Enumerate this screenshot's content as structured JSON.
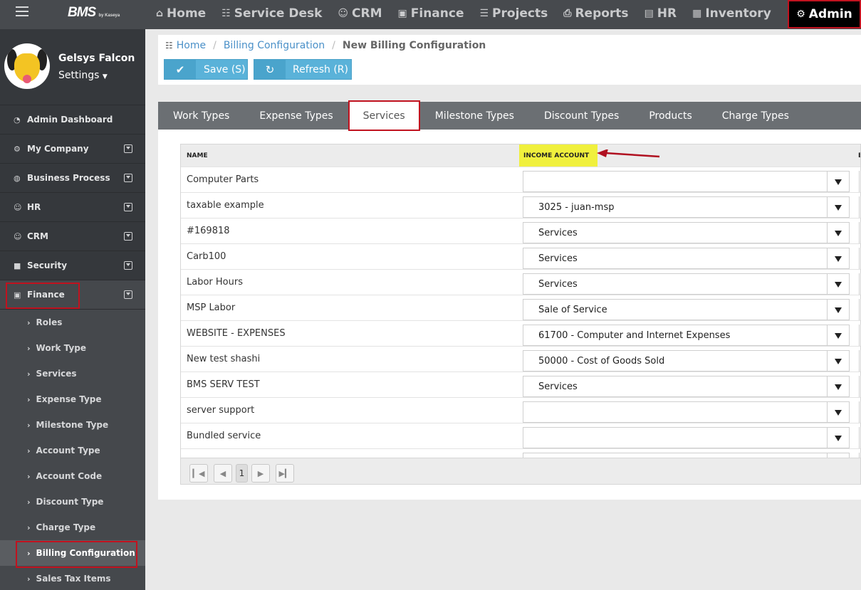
{
  "topbar": {
    "brand": "BMS",
    "brand_sub": "by Kaseya",
    "nav": [
      {
        "label": "Home",
        "icon": "home-icon",
        "glyph": "⌂"
      },
      {
        "label": "Service Desk",
        "icon": "sitemap-icon",
        "glyph": "☷"
      },
      {
        "label": "CRM",
        "icon": "users-icon",
        "glyph": "☺"
      },
      {
        "label": "Finance",
        "icon": "money-icon",
        "glyph": "▣"
      },
      {
        "label": "Projects",
        "icon": "tasks-icon",
        "glyph": "☰"
      },
      {
        "label": "Reports",
        "icon": "print-icon",
        "glyph": "⎙"
      },
      {
        "label": "HR",
        "icon": "briefcase-icon",
        "glyph": "▤"
      },
      {
        "label": "Inventory",
        "icon": "building-icon",
        "glyph": "▦"
      }
    ],
    "admin": {
      "label": "Admin",
      "icon": "gear-icon",
      "glyph": "⚙"
    }
  },
  "profile": {
    "name": "Gelsys Falcon",
    "settings_label": "Settings"
  },
  "sidebar": {
    "items": [
      {
        "label": "Admin Dashboard",
        "glyph": "◔"
      },
      {
        "label": "My Company",
        "glyph": "⚙"
      },
      {
        "label": "Business Process",
        "glyph": "◍"
      },
      {
        "label": "HR",
        "glyph": "☺"
      },
      {
        "label": "CRM",
        "glyph": "☺"
      },
      {
        "label": "Security",
        "glyph": "■"
      },
      {
        "label": "Finance",
        "glyph": "▣"
      }
    ],
    "finance_sub": [
      "Roles",
      "Work Type",
      "Services",
      "Expense Type",
      "Milestone Type",
      "Account Type",
      "Account Code",
      "Discount Type",
      "Charge Type",
      "Billing Configuration",
      "Sales Tax Items"
    ]
  },
  "breadcrumb": {
    "home": "Home",
    "parent": "Billing Configuration",
    "current": "New Billing Configuration"
  },
  "toolbar": {
    "save_label": "Save (S)",
    "refresh_label": "Refresh (R)"
  },
  "tabs": [
    "Work Types",
    "Expense Types",
    "Services",
    "Milestone Types",
    "Discount Types",
    "Products",
    "Charge Types"
  ],
  "active_tab": "Services",
  "grid": {
    "headers": {
      "name": "NAME",
      "income": "INCOME ACCOUNT",
      "extra": "E"
    },
    "rows": [
      {
        "name": "Computer Parts",
        "income": ""
      },
      {
        "name": "taxable example",
        "income": "3025 - juan-msp"
      },
      {
        "name": "#169818",
        "income": "Services"
      },
      {
        "name": "Carb100",
        "income": "Services"
      },
      {
        "name": "Labor Hours",
        "income": "Services"
      },
      {
        "name": "MSP Labor",
        "income": "Sale of Service"
      },
      {
        "name": "WEBSITE - EXPENSES",
        "income": "61700 - Computer and Internet Expenses"
      },
      {
        "name": "New test shashi",
        "income": "50000 - Cost of Goods Sold"
      },
      {
        "name": "BMS SERV TEST",
        "income": "Services"
      },
      {
        "name": "server support",
        "income": ""
      },
      {
        "name": "Bundled service",
        "income": ""
      },
      {
        "name": "",
        "income": ""
      }
    ],
    "pager": {
      "page": "1"
    }
  },
  "colors": {
    "highlight_border": "#c1121f",
    "button": "#5ab2d9",
    "header_highlight": "#f0f03d",
    "arrow": "#b01020"
  }
}
